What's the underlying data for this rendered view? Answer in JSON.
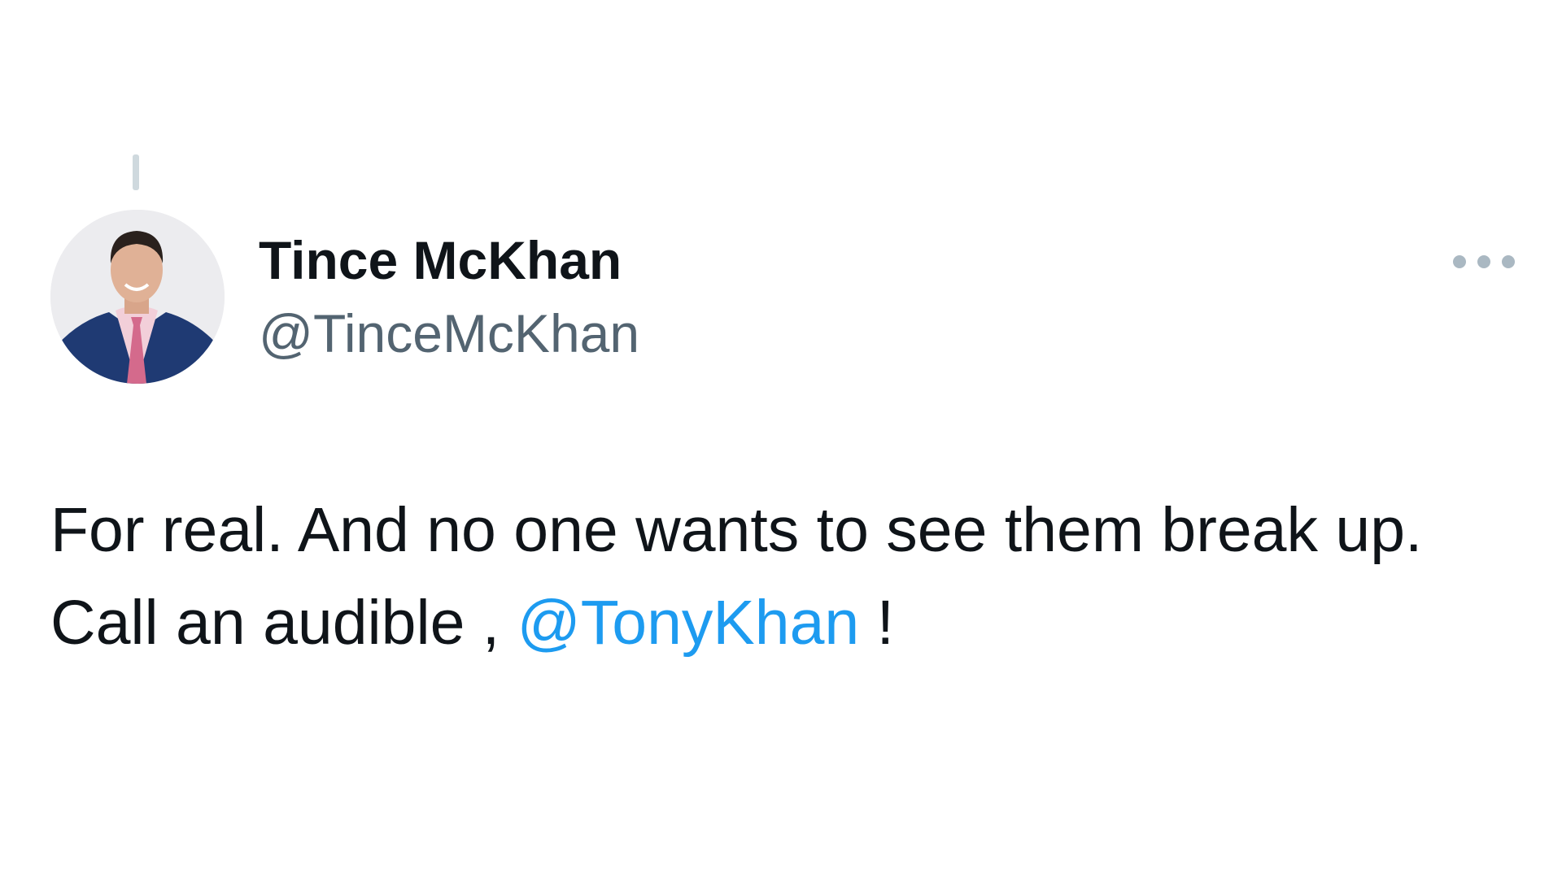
{
  "author": {
    "display_name": "Tince McKhan",
    "handle": "@TinceMcKhan"
  },
  "tweet": {
    "line1": "For real. And no one wants to see them break up.",
    "line2_prefix": "Call an audible , ",
    "mention": "@TonyKhan",
    "line2_suffix": " !"
  },
  "icons": {
    "more": "more-horizontal-icon",
    "avatar": "profile-photo"
  },
  "colors": {
    "text_primary": "#0f1419",
    "text_secondary": "#536471",
    "link": "#1d9bf0",
    "thread_line": "#cfd9de",
    "background": "#ffffff"
  }
}
